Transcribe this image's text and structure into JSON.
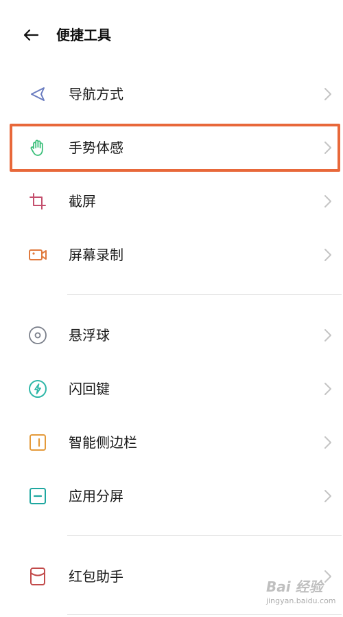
{
  "header": {
    "title": "便捷工具",
    "back_icon": "arrow-left-icon"
  },
  "groups": [
    {
      "items": [
        {
          "label": "导航方式",
          "icon": "navigation-arrow-icon",
          "color": "#6a7cc0"
        },
        {
          "label": "手势体感",
          "icon": "hand-gesture-icon",
          "color": "#3bbf7a",
          "highlighted": true
        },
        {
          "label": "截屏",
          "icon": "crop-icon",
          "color": "#c44f6d"
        },
        {
          "label": "屏幕录制",
          "icon": "video-camera-icon",
          "color": "#e07a3e"
        }
      ]
    },
    {
      "items": [
        {
          "label": "悬浮球",
          "icon": "floating-ball-icon",
          "color": "#7a7f8a"
        },
        {
          "label": "闪回键",
          "icon": "flash-icon",
          "color": "#2fb7a8"
        },
        {
          "label": "智能侧边栏",
          "icon": "sidebar-icon",
          "color": "#e49a3a"
        },
        {
          "label": "应用分屏",
          "icon": "split-screen-icon",
          "color": "#1fa7a0"
        }
      ]
    },
    {
      "items": [
        {
          "label": "红包助手",
          "icon": "envelope-icon",
          "color": "#c24a4a"
        }
      ]
    }
  ],
  "highlight_color": "#e8683a",
  "watermark": {
    "text": "Bai 经验",
    "url": "jingyan.baidu.com"
  }
}
